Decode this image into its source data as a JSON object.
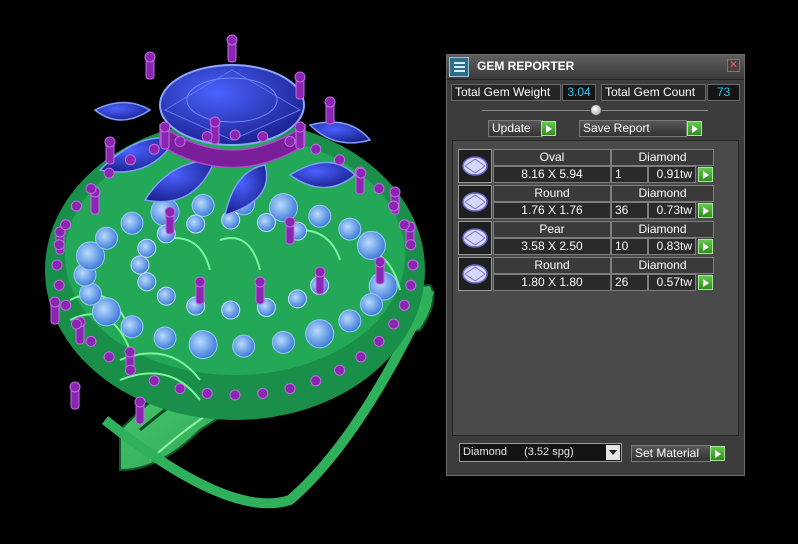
{
  "panel": {
    "title": "GEM REPORTER",
    "close_symbol": "✕",
    "total_weight_label": "Total Gem Weight",
    "total_weight_value": "3.04",
    "total_count_label": "Total Gem Count",
    "total_count_value": "73",
    "update_label": "Update",
    "save_report_label": "Save Report",
    "gems": [
      {
        "shape": "Oval",
        "size": "8.16 X 5.94",
        "material": "Diamond",
        "count": "1",
        "weight": "0.91tw"
      },
      {
        "shape": "Round",
        "size": "1.76 X 1.76",
        "material": "Diamond",
        "count": "36",
        "weight": "0.73tw"
      },
      {
        "shape": "Pear",
        "size": "3.58 X 2.50",
        "material": "Diamond",
        "count": "10",
        "weight": "0.83tw"
      },
      {
        "shape": "Round",
        "size": "1.80 X 1.80",
        "material": "Diamond",
        "count": "26",
        "weight": "0.57tw"
      }
    ],
    "material_select": {
      "name": "Diamond",
      "spg": "(3.52 spg)"
    },
    "set_material_label": "Set Material"
  },
  "icons": {
    "title": "gem-reporter-icon",
    "close": "close-icon",
    "arrow": "play-arrow-icon",
    "dropdown": "chevron-down-icon",
    "thumbnail": "gem-thumbnail-icon"
  },
  "colors": {
    "panel_bg": "#3c3c3c",
    "value_text": "#29c6f0",
    "arrow_green": "#3fae2a",
    "metal_green": "#3fc46a",
    "prong_purple": "#7a1e9a",
    "gem_blue": "#2430b0",
    "round_gem_blue": "#5a9ae6"
  }
}
